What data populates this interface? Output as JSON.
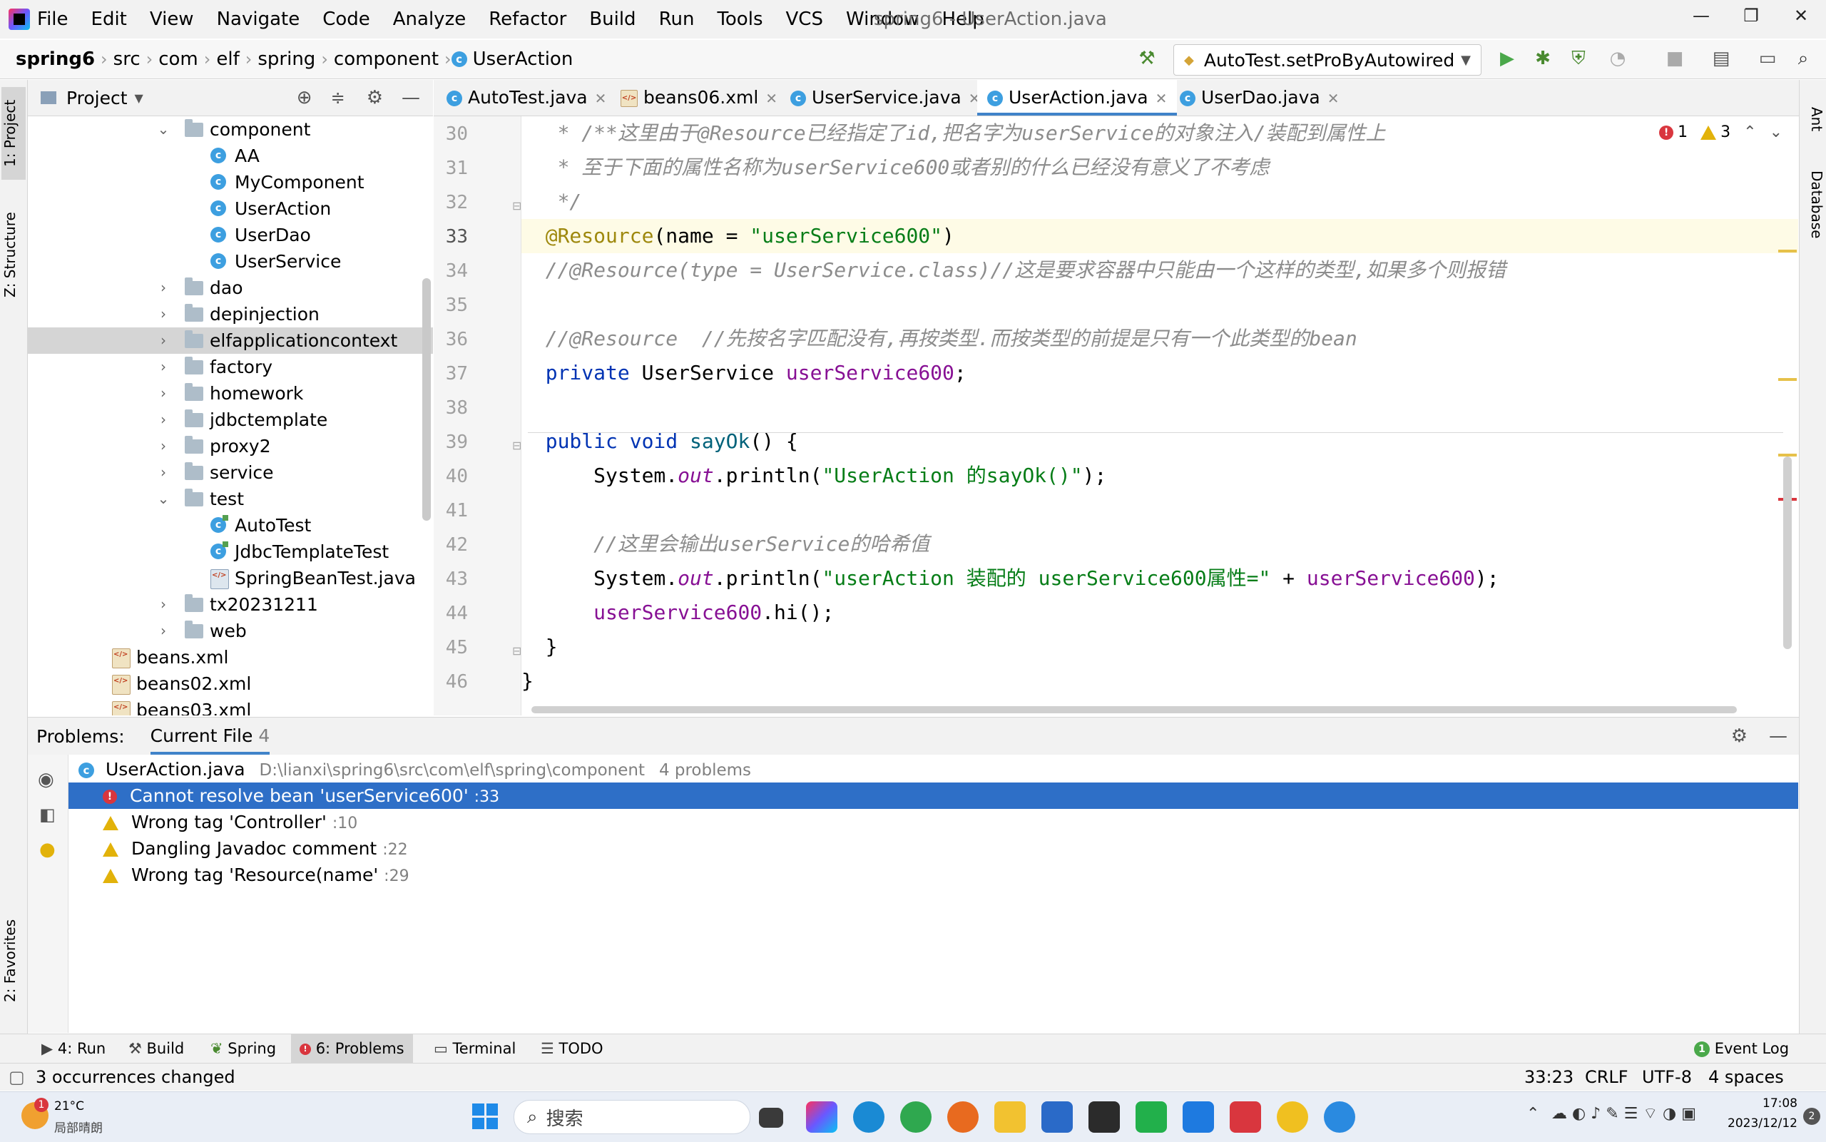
{
  "window": {
    "title": "spring6 - UserAction.java",
    "menu": [
      "File",
      "Edit",
      "View",
      "Navigate",
      "Code",
      "Analyze",
      "Refactor",
      "Build",
      "Run",
      "Tools",
      "VCS",
      "Window",
      "Help"
    ],
    "controls": {
      "minimize": "—",
      "restore": "❐",
      "close": "✕"
    }
  },
  "breadcrumb": [
    "spring6",
    "src",
    "com",
    "elf",
    "spring",
    "component",
    "UserAction"
  ],
  "run_config": "AutoTest.setProByAutowired",
  "left_stripe": {
    "project": "1: Project",
    "structure": "Z: Structure",
    "favorites": "2: Favorites"
  },
  "right_stripe": {
    "ant": "Ant",
    "database": "Database"
  },
  "project_panel": {
    "title": "Project",
    "tree": [
      {
        "label": "component",
        "type": "folder",
        "open": true
      },
      {
        "label": "AA",
        "type": "class"
      },
      {
        "label": "MyComponent",
        "type": "class"
      },
      {
        "label": "UserAction",
        "type": "class"
      },
      {
        "label": "UserDao",
        "type": "class"
      },
      {
        "label": "UserService",
        "type": "class"
      },
      {
        "label": "dao",
        "type": "folder"
      },
      {
        "label": "depinjection",
        "type": "folder"
      },
      {
        "label": "elfapplicationcontext",
        "type": "folder",
        "selected": true
      },
      {
        "label": "factory",
        "type": "folder"
      },
      {
        "label": "homework",
        "type": "folder"
      },
      {
        "label": "jdbctemplate",
        "type": "folder"
      },
      {
        "label": "proxy2",
        "type": "folder"
      },
      {
        "label": "service",
        "type": "folder"
      },
      {
        "label": "test",
        "type": "folder",
        "open": true
      },
      {
        "label": "AutoTest",
        "type": "test"
      },
      {
        "label": "JdbcTemplateTest",
        "type": "test"
      },
      {
        "label": "SpringBeanTest.java",
        "type": "java"
      },
      {
        "label": "tx20231211",
        "type": "folder"
      },
      {
        "label": "web",
        "type": "folder"
      },
      {
        "label": "beans.xml",
        "type": "xml"
      },
      {
        "label": "beans02.xml",
        "type": "xml"
      },
      {
        "label": "beans03.xml",
        "type": "xml"
      }
    ]
  },
  "tabs": [
    {
      "label": "AutoTest.java",
      "kind": "class"
    },
    {
      "label": "beans06.xml",
      "kind": "xml"
    },
    {
      "label": "UserService.java",
      "kind": "class"
    },
    {
      "label": "UserAction.java",
      "kind": "class",
      "active": true
    },
    {
      "label": "UserDao.java",
      "kind": "class"
    }
  ],
  "editor": {
    "error_count": "1",
    "warning_count": "3",
    "line_numbers": [
      "30",
      "31",
      "32",
      "33",
      "34",
      "35",
      "36",
      "37",
      "38",
      "39",
      "40",
      "41",
      "42",
      "43",
      "44",
      "45",
      "46"
    ],
    "current_line": "33"
  },
  "problems": {
    "label": "Problems:",
    "tab": "Current File",
    "tab_count": "4",
    "file": "UserAction.java",
    "path": "D:\\lianxi\\spring6\\src\\com\\elf\\spring\\component",
    "summary": "4 problems",
    "items": [
      {
        "severity": "error",
        "text": "Cannot resolve bean 'userService600'",
        "line": ":33"
      },
      {
        "severity": "warning",
        "text": "Wrong tag 'Controller'",
        "line": ":10"
      },
      {
        "severity": "warning",
        "text": "Dangling Javadoc comment",
        "line": ":22"
      },
      {
        "severity": "warning",
        "text": "Wrong tag 'Resource(name'",
        "line": ":29"
      }
    ]
  },
  "toolwindows": {
    "run": "4: Run",
    "build": "Build",
    "spring": "Spring",
    "problems": "6: Problems",
    "terminal": "Terminal",
    "todo": "TODO",
    "event_log": "Event Log",
    "event_count": "1"
  },
  "status": {
    "message": "3 occurrences changed",
    "position": "33:23",
    "line_sep": "CRLF",
    "encoding": "UTF-8",
    "indent": "4 spaces"
  },
  "taskbar": {
    "weather_temp": "21°C",
    "weather_desc": "局部晴朗",
    "weather_badge": "1",
    "search": "搜索",
    "time": "17:08",
    "date": "2023/12/12",
    "notif": "2"
  }
}
